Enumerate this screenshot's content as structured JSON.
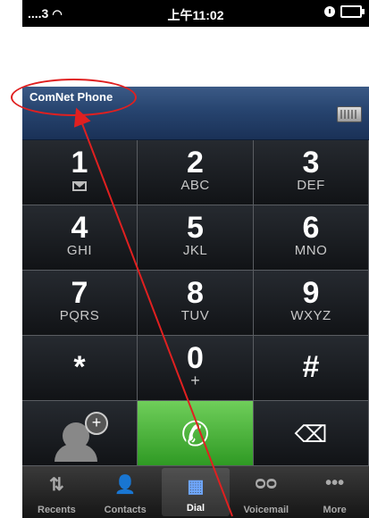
{
  "status_bar": {
    "carrier": "....3",
    "time": "上午11:02"
  },
  "app": {
    "title": "ComNet Phone"
  },
  "keypad": {
    "keys": [
      {
        "digit": "1",
        "letters": ""
      },
      {
        "digit": "2",
        "letters": "ABC"
      },
      {
        "digit": "3",
        "letters": "DEF"
      },
      {
        "digit": "4",
        "letters": "GHI"
      },
      {
        "digit": "5",
        "letters": "JKL"
      },
      {
        "digit": "6",
        "letters": "MNO"
      },
      {
        "digit": "7",
        "letters": "PQRS"
      },
      {
        "digit": "8",
        "letters": "TUV"
      },
      {
        "digit": "9",
        "letters": "WXYZ"
      },
      {
        "digit": "*",
        "letters": ""
      },
      {
        "digit": "0",
        "letters": "+"
      },
      {
        "digit": "#",
        "letters": ""
      }
    ]
  },
  "icons": {
    "add_contact": "add-contact-icon",
    "call": "phone-icon",
    "backspace": "backspace-icon",
    "keyboard": "keyboard-icon",
    "voicemail_glyph": "voicemail-icon"
  },
  "tabbar": {
    "tabs": [
      {
        "label": "Recents"
      },
      {
        "label": "Contacts"
      },
      {
        "label": "Dial"
      },
      {
        "label": "Voicemail"
      },
      {
        "label": "More"
      }
    ],
    "active": "Dial"
  },
  "colors": {
    "header_blue": "#27446f",
    "call_green": "#3fae33",
    "annotation_red": "#e02020"
  }
}
